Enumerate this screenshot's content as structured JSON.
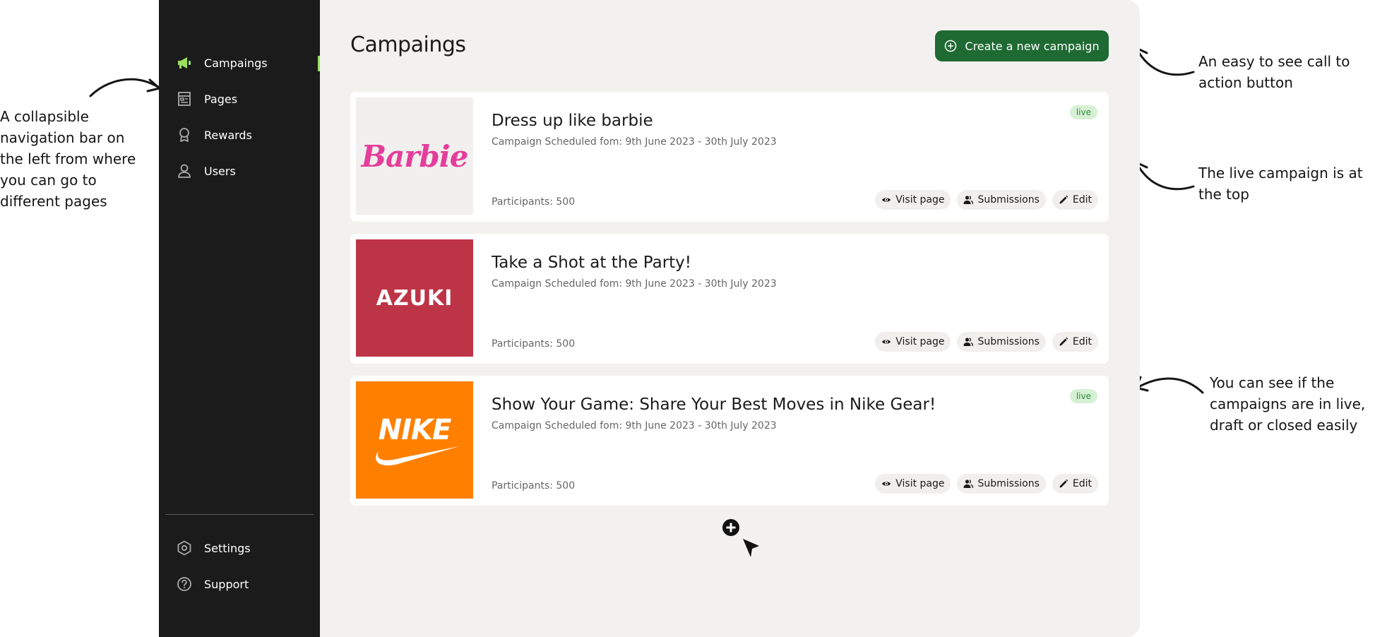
{
  "annotations": {
    "left": "A collapsible\nnavigation bar on\nthe left from where\nyou can go to\ndifferent pages",
    "cta": "An easy to see call to\naction button",
    "live": "The live campaign is at\nthe top",
    "status": "You can see if the\ncampaigns are in live,\ndraft or closed easily"
  },
  "sidebar": {
    "items": [
      {
        "label": "Campaings",
        "icon": "megaphone-icon",
        "active": true
      },
      {
        "label": "Pages",
        "icon": "page-icon"
      },
      {
        "label": "Rewards",
        "icon": "award-icon"
      },
      {
        "label": "Users",
        "icon": "user-icon"
      }
    ],
    "bottom_items": [
      {
        "label": "Settings",
        "icon": "gear-icon"
      },
      {
        "label": "Support",
        "icon": "help-icon"
      }
    ],
    "active_color": "#9be15d"
  },
  "main": {
    "title": "Campaings",
    "cta_label": "Create a new campaign",
    "cta_color": "#1e6a32"
  },
  "campaigns": [
    {
      "title": "Dress up like barbie",
      "schedule": "Campaign Scheduled fom: 9th June 2023 - 30th July 2023",
      "participants": "Participants: 500",
      "status": "live",
      "logo_text": "Barbie",
      "logo_bg": "#f1f0ee",
      "logo_color": "#e43d9a"
    },
    {
      "title": "Take a Shot at the Party!",
      "schedule": "Campaign Scheduled fom: 9th June 2023 - 30th July 2023",
      "participants": "Participants: 500",
      "status": "",
      "logo_text": "AZUKI",
      "logo_bg": "#bd3446",
      "logo_color": "#ffffff"
    },
    {
      "title": "Show Your Game: Share Your Best Moves in Nike Gear!",
      "schedule": "Campaign Scheduled fom: 9th June 2023 - 30th July 2023",
      "participants": "Participants: 500",
      "status": "live",
      "logo_text": "NIKE",
      "logo_bg": "#ff8000",
      "logo_color": "#ffffff"
    }
  ],
  "actions": {
    "visit": "Visit page",
    "submissions": "Submissions",
    "edit": "Edit"
  },
  "status_color": "#2f8a3a"
}
